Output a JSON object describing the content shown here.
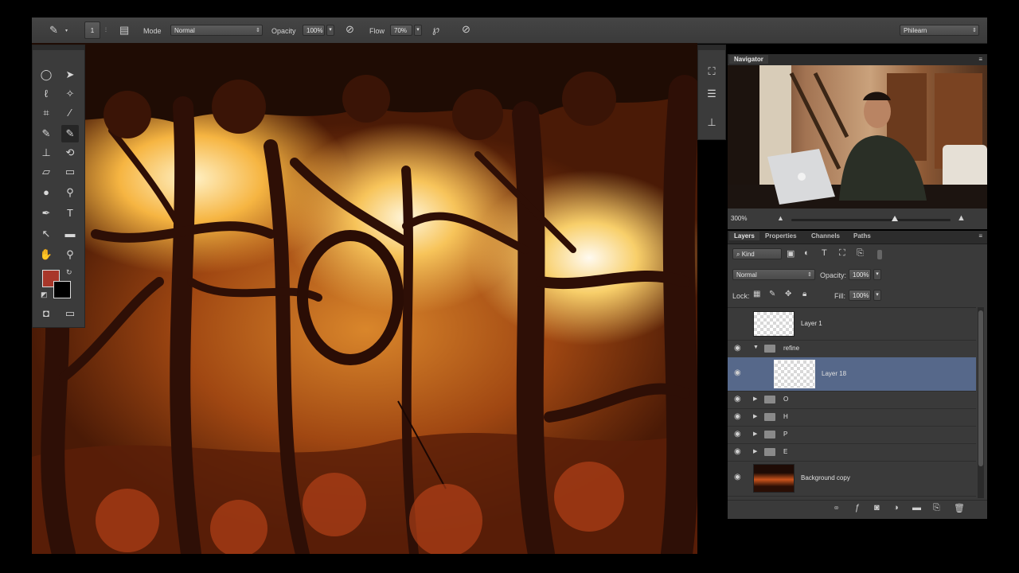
{
  "options_bar": {
    "brush_size": "1",
    "mode_label": "Mode",
    "mode_value": "Normal",
    "opacity_label": "Opacity",
    "opacity_value": "100%",
    "flow_label": "Flow",
    "flow_value": "70%",
    "workspace_value": "Philearn"
  },
  "navigator": {
    "tab_label": "Navigator",
    "zoom_value": "300%"
  },
  "layers_panel": {
    "tabs": [
      "Layers",
      "Properties",
      "Channels",
      "Paths"
    ],
    "filter_kind": "Kind",
    "blend_mode": "Normal",
    "opacity_label": "Opacity:",
    "opacity_value": "100%",
    "lock_label": "Lock:",
    "fill_label": "Fill:",
    "fill_value": "100%",
    "layers": [
      {
        "name": "Layer 1",
        "type": "layer",
        "visible": false
      },
      {
        "name": "refine",
        "type": "group",
        "visible": true,
        "expanded": true
      },
      {
        "name": "Layer 18",
        "type": "layer",
        "visible": true,
        "selected": true
      },
      {
        "name": "O",
        "type": "group",
        "visible": true
      },
      {
        "name": "H",
        "type": "group",
        "visible": true
      },
      {
        "name": "P",
        "type": "group",
        "visible": true
      },
      {
        "name": "E",
        "type": "group",
        "visible": true
      },
      {
        "name": "Background copy",
        "type": "layer",
        "visible": true
      }
    ]
  },
  "colors": {
    "foreground": "#a8372a",
    "background": "#000000",
    "selected_row": "#56688a",
    "panel": "#3a3a3a"
  }
}
